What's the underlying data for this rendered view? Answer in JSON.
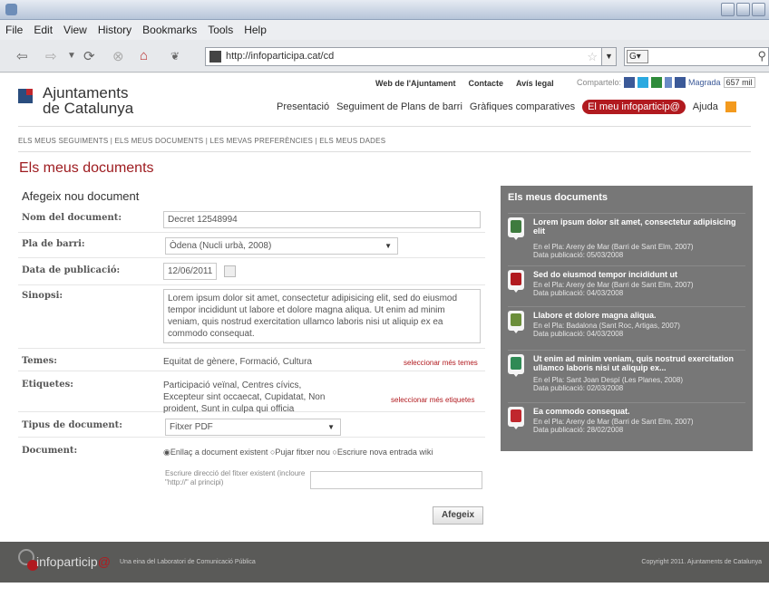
{
  "browser": {
    "menu": [
      "File",
      "Edit",
      "View",
      "History",
      "Bookmarks",
      "Tools",
      "Help"
    ],
    "url": "http://infoparticipa.cat/cd",
    "search_engine": "G"
  },
  "site": {
    "logo_line1": "Ajuntaments",
    "logo_line2": "de Catalunya",
    "toplinks": [
      "Web de l'Ajuntament",
      "Contacte",
      "Avís legal"
    ],
    "share_label": "Compartelo:",
    "share_badge": "Magrada",
    "share_count": "657 mil",
    "nav": [
      "Presentació",
      "Seguiment de Plans de barri",
      "Gràfiques comparatives",
      "El meu infoparticip@",
      "Ajuda"
    ],
    "subnav": "ELS MEUS SEGUIMENTS  |  ELS MEUS DOCUMENTS  |  LES MEVAS PREFERÈNCIES  |  ELS MEUS DADES"
  },
  "page_title": "Els meus documents",
  "form": {
    "section_title": "Afegeix nou document",
    "name_label": "Nom del document:",
    "name_value": "Decret 12548994",
    "pla_label": "Pla de barri:",
    "pla_value": "Òdena (Nucli urbà, 2008)",
    "date_label": "Data de publicació:",
    "date_value": "12/06/2011",
    "sinopsi_label": "Sinopsi:",
    "sinopsi_value": "Lorem ipsum dolor sit amet, consectetur adipisicing elit, sed do eiusmod tempor incididunt ut labore et dolore magna aliqua. Ut enim ad minim veniam, quis nostrud exercitation ullamco laboris nisi ut aliquip ex ea commodo consequat.",
    "temes_label": "Temes:",
    "temes_value": "Equitat de gènere, Formació, Cultura",
    "temes_link": "seleccionar més temes",
    "etiq_label": "Etiquetes:",
    "etiq_value": "Participació veïnal, Centres cívics, Excepteur sint occaecat, Cupidatat, Non proident, Sunt in culpa qui officia",
    "etiq_link": "seleccionar més etiquetes",
    "tipus_label": "Tipus de document:",
    "tipus_value": "Fitxer PDF",
    "doc_label": "Document:",
    "doc_opt1": "Enllaç a document existent",
    "doc_opt2": "Pujar fitxer nou",
    "doc_opt3": "Escriure nova entrada wiki",
    "doc_help": "Escriure direcció del fitxer existent (incloure \"http://\" al principi)",
    "submit_label": "Afegeix"
  },
  "sidebar": {
    "title": "Els meus documents",
    "items": [
      {
        "title": "Lorem ipsum dolor sit amet, consectetur adipisicing elit",
        "meta1": "En el Pla:  Areny de Mar (Barri de Sant Elm, 2007)",
        "meta2": "Data publicació: 05/03/2008",
        "color": "#3e7b3e"
      },
      {
        "title": "Sed do eiusmod tempor incididunt ut",
        "meta1": "En el Pla:  Areny de Mar (Barri de Sant Elm, 2007)",
        "meta2": "Data publicació: 04/03/2008",
        "color": "#b11a1f"
      },
      {
        "title": "Llabore et dolore magna aliqua.",
        "meta1": "En el Pla:  Badalona (Sant Roc, Artigas, 2007)",
        "meta2": "Data publicació: 04/03/2008",
        "color": "#6b8e3a"
      },
      {
        "title": "Ut enim ad minim veniam, quis nostrud exercitation ullamco laboris nisi ut aliquip ex...",
        "meta1": "En el Pla:  Sant Joan Despí (Les Planes, 2008)",
        "meta2": "Data publicació: 02/03/2008",
        "color": "#2f8a55"
      },
      {
        "title": "Ea commodo consequat.",
        "meta1": "En el Pla:  Areny de Mar (Barri de Sant Elm, 2007)",
        "meta2": "Data publicació: 28/02/2008",
        "color": "#c0272d"
      }
    ]
  },
  "footer": {
    "brand_a": "infoparticip",
    "brand_b": "@",
    "tagline": "Una eina del Laboratori de Comunicació Pública",
    "copyright": "Copyright 2011. Ajuntaments de Catalunya"
  }
}
